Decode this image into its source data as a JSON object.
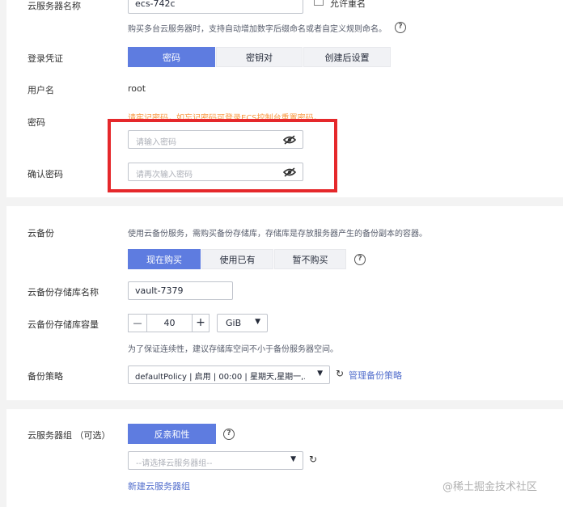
{
  "section1": {
    "server_name_label": "云服务器名称",
    "server_name_value": "ecs-742c",
    "allow_dup_label": "允许重名",
    "batch_hint": "购买多台云服务器时，支持自动增加数字后缀命名或者自定义规则命名。",
    "login_label": "登录凭证",
    "login_options": [
      "密码",
      "密钥对",
      "创建后设置"
    ],
    "username_label": "用户名",
    "username_value": "root",
    "password_label": "密码",
    "password_warning": "请牢记密码，如忘记密码可登录ECS控制台重置密码。",
    "password_placeholder": "请输入密码",
    "confirm_label": "确认密码",
    "confirm_placeholder": "请再次输入密码"
  },
  "section2": {
    "backup_label": "云备份",
    "backup_desc": "使用云备份服务，需购买备份存储库，存储库是存放服务器产生的备份副本的容器。",
    "backup_options": [
      "现在购买",
      "使用已有",
      "暂不购买"
    ],
    "vault_name_label": "云备份存储库名称",
    "vault_name_value": "vault-7379",
    "capacity_label": "云备份存储库容量",
    "capacity_minus": "—",
    "capacity_value": "40",
    "capacity_plus": "+",
    "capacity_unit": "GiB",
    "capacity_hint": "为了保证连续性，建议存储库空间不小于备份服务器空间。",
    "policy_label": "备份策略",
    "policy_value": "defaultPolicy | 启用 | 00:00 | 星期天,星期一,...",
    "manage_policy_link": "管理备份策略"
  },
  "section3": {
    "group_label": "云服务器组 （可选）",
    "anti_affinity_button": "反亲和性",
    "group_placeholder": "--请选择云服务器组--",
    "new_group_link": "新建云服务器组"
  },
  "watermark": "@稀土掘金技术社区",
  "colors": {
    "primary": "#5e7ce0",
    "warning": "#fa9841",
    "highlight_box": "#e5282b",
    "link": "#526ecc"
  }
}
